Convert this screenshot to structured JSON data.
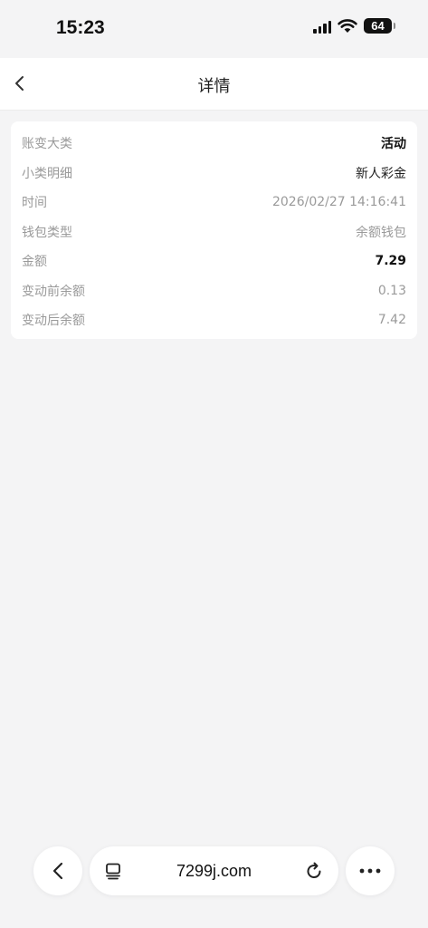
{
  "status_bar": {
    "time": "15:23",
    "battery": "64",
    "icons": [
      "signal-icon",
      "wifi-icon",
      "battery-icon"
    ]
  },
  "header": {
    "title": "详情",
    "back_icon": "chevron-left-icon"
  },
  "details": [
    {
      "label": "账变大类",
      "value": "活动"
    },
    {
      "label": "小类明细",
      "value": "新人彩金"
    },
    {
      "label": "时间",
      "value": "2026/02/27 14:16:41"
    },
    {
      "label": "钱包类型",
      "value": "余额钱包"
    },
    {
      "label": "金额",
      "value": "7.29"
    },
    {
      "label": "变动前余额",
      "value": "0.13"
    },
    {
      "label": "变动后余额",
      "value": "7.42"
    }
  ],
  "browser_bar": {
    "url": "7299j.com",
    "icons": [
      "back-icon",
      "tabs-icon",
      "reload-icon",
      "more-icon"
    ]
  }
}
